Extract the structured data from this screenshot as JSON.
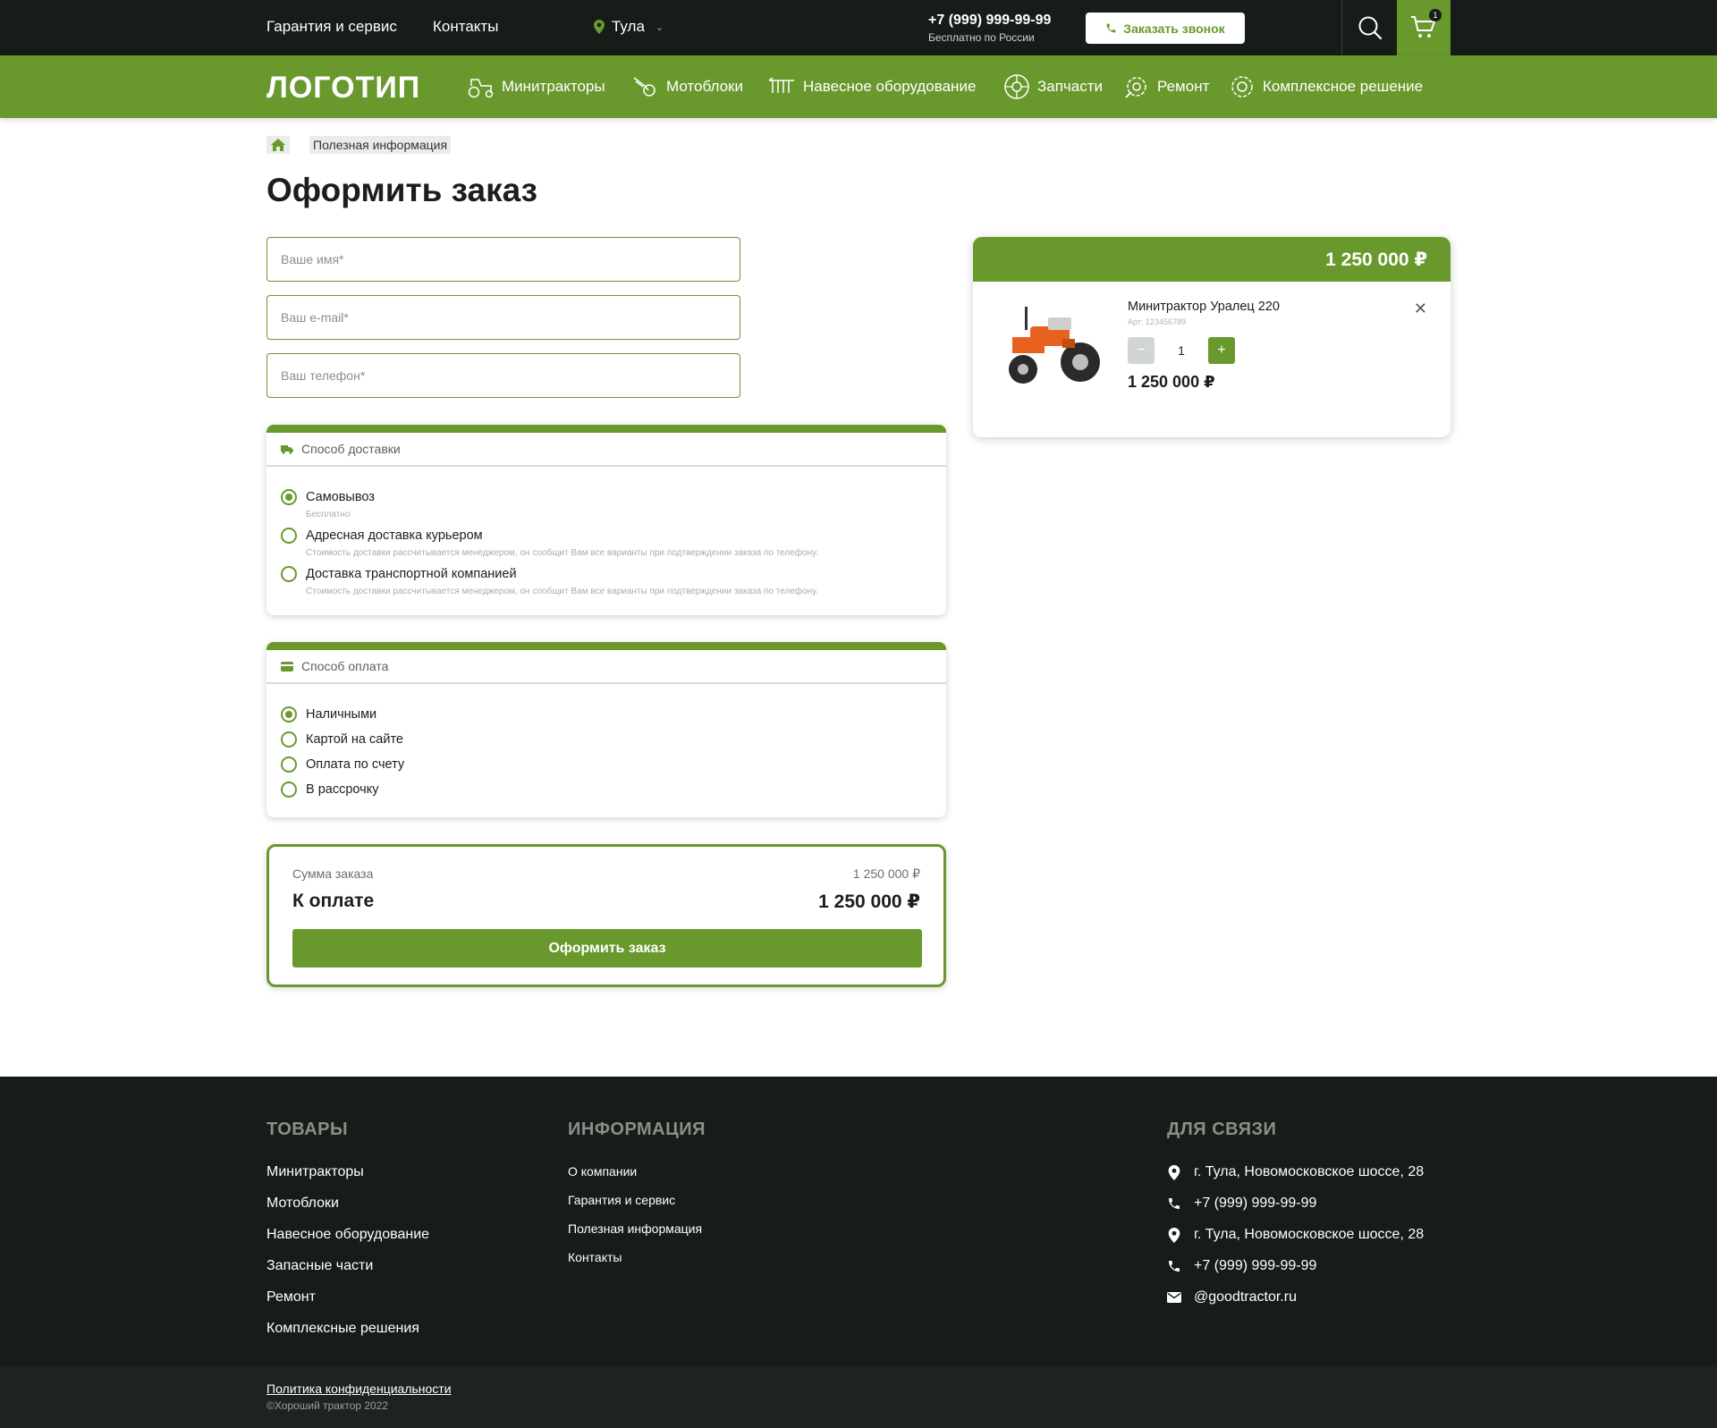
{
  "topbar": {
    "links": [
      "Гарантия и сервис",
      "Контакты"
    ],
    "city": "Тула",
    "phone": "+7 (999) 999-99-99",
    "phone_sub": "Бесплатно по России",
    "callback": "Заказать звонок",
    "cart_count": "1"
  },
  "nav": {
    "logo": "ЛОГОТИП",
    "items": [
      "Минитракторы",
      "Мотоблоки",
      "Навесное оборудование",
      "Запчасти",
      "Ремонт",
      "Комплексное решение"
    ]
  },
  "breadcrumb": {
    "item": "Полезная информация"
  },
  "page_title": "Оформить заказ",
  "form": {
    "name_placeholder": "Ваше имя*",
    "email_placeholder": "Ваш e-mail*",
    "phone_placeholder": "Ваш телефон*"
  },
  "delivery": {
    "title": "Способ доставки",
    "options": [
      {
        "label": "Самовывоз",
        "note": "Бесплатно"
      },
      {
        "label": "Адресная доставка курьером",
        "note": "Стоимость доставки рассчитывается менеджером, он сообщит Вам все варианты при подтверждении заказа по телефону."
      },
      {
        "label": "Доставка транспортной компанией",
        "note": "Стоимость доставки рассчитывается менеджером, он сообщит Вам все варианты при подтверждении заказа по телефону."
      }
    ]
  },
  "payment": {
    "title": "Способ оплата",
    "options": [
      "Наличными",
      "Картой на сайте",
      "Оплата по счету",
      "В рассрочку"
    ]
  },
  "summary": {
    "sum_label": "Сумма заказа",
    "sum_value": "1 250 000 ₽",
    "pay_label": "К оплате",
    "pay_value": "1 250 000 ₽",
    "submit": "Оформить заказ"
  },
  "cart": {
    "total": "1 250 000 ₽",
    "product": {
      "name": "Минитрактор Уралец 220",
      "article": "Арт: 123456789",
      "qty": "1",
      "price": "1 250 000 ₽"
    }
  },
  "footer": {
    "goods_title": "ТОВАРЫ",
    "goods": [
      "Минитракторы",
      "Мотоблоки",
      "Навесное оборудование",
      "Запасные части",
      "Ремонт",
      "Комплексные решения"
    ],
    "info_title": "ИНФОРМАЦИЯ",
    "info": [
      "О компании",
      "Гарантия и сервис",
      "Полезная информация",
      "Контакты"
    ],
    "contact_title": "ДЛЯ СВЯЗИ",
    "contacts": [
      "г. Тула, Новомосковское шоссе, 28",
      "+7 (999) 999-99-99",
      "г. Тула, Новомосковское шоссе, 28",
      "+7 (999) 999-99-99",
      "@goodtractor.ru"
    ],
    "policy": "Политика конфиденциальности",
    "copyright": "©Хороший трактор 2022"
  },
  "colors": {
    "accent": "#69992d",
    "dark": "#161c17"
  }
}
